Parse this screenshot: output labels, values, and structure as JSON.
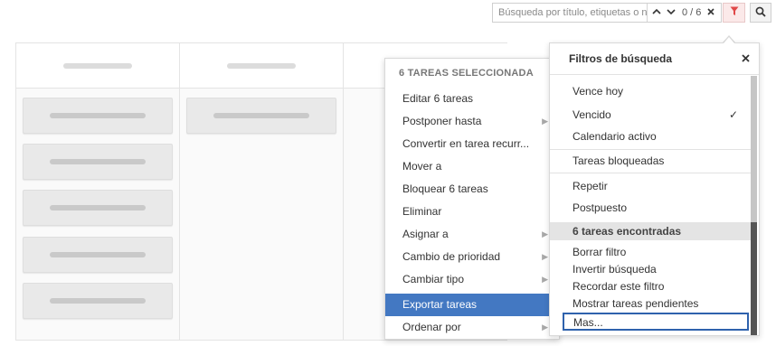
{
  "search": {
    "placeholder": "Búsqueda por título, etiquetas o notas",
    "counter": "0 / 6",
    "prev_icon": "chevron-up-icon",
    "next_icon": "chevron-down-icon",
    "clear_icon": "close-icon"
  },
  "toolbar": {
    "filter_icon": "filter-icon",
    "search_icon": "search-icon",
    "filter_active_color": "#e04848"
  },
  "context_menu": {
    "header": "6 TAREAS SELECCIONADA",
    "items": [
      {
        "label": "Editar 6 tareas",
        "submenu": false
      },
      {
        "label": "Postponer hasta",
        "submenu": true
      },
      {
        "label": "Convertir en tarea recurr...",
        "submenu": false
      },
      {
        "label": "Mover a",
        "submenu": false
      },
      {
        "label": "Bloquear 6 tareas",
        "submenu": false
      },
      {
        "label": "Eliminar",
        "submenu": false
      },
      {
        "label": "Asignar a",
        "submenu": true
      },
      {
        "label": "Cambio de prioridad",
        "submenu": true
      },
      {
        "label": "Cambiar tipo",
        "submenu": true
      },
      {
        "label": "Exportar tareas",
        "submenu": false,
        "active": true
      },
      {
        "label": "Ordenar por",
        "submenu": true
      }
    ],
    "highlight_color": "#4378c2"
  },
  "filter_panel": {
    "title": "Filtros de búsqueda",
    "close_icon": "close-icon",
    "group1": [
      {
        "label": "Vence hoy",
        "checked": false
      },
      {
        "label": "Vencido",
        "checked": true,
        "check": "✓"
      },
      {
        "label": "Calendario activo",
        "checked": false
      }
    ],
    "group2": [
      {
        "label": "Tareas bloqueadas"
      }
    ],
    "group3": [
      {
        "label": "Repetir"
      },
      {
        "label": "Postpuesto"
      }
    ],
    "results_header": "6 tareas encontradas",
    "actions": [
      {
        "label": "Borrar filtro"
      },
      {
        "label": "Invertir búsqueda"
      },
      {
        "label": "Recordar este filtro"
      },
      {
        "label": "Mostrar tareas pendientes"
      },
      {
        "label": "Mas..."
      }
    ]
  }
}
